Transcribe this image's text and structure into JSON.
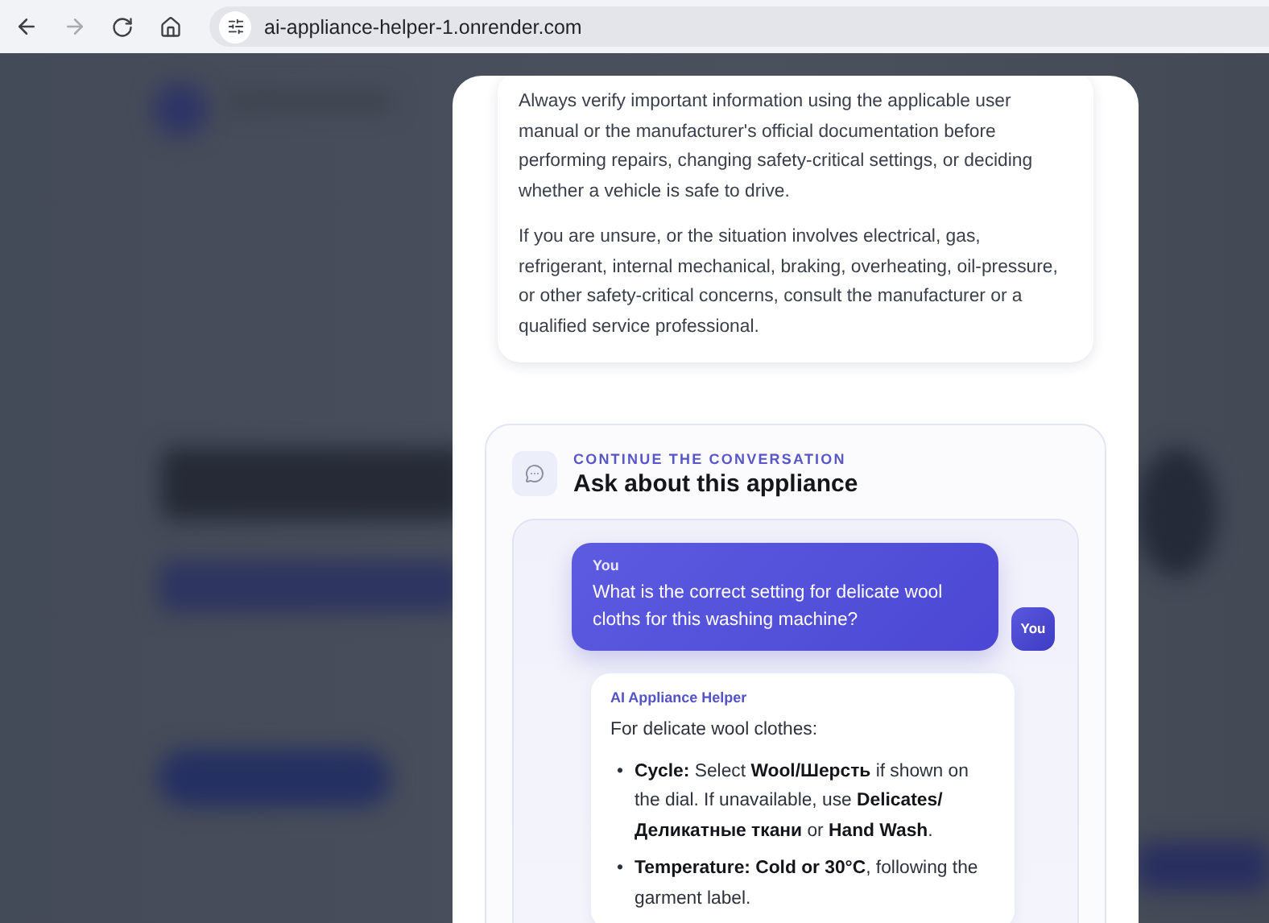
{
  "browser": {
    "url": "ai-appliance-helper-1.onrender.com",
    "forward_disabled": true
  },
  "disclaimer": {
    "paragraphs": [
      "Always verify important information using the applicable user manual or the manufacturer's official documentation before performing repairs, changing safety-critical settings, or deciding whether a vehicle is safe to drive.",
      "If you are unsure, or the situation involves electrical, gas, refrigerant, internal mechanical, braking, overheating, oil-pressure, or other safety-critical concerns, consult the manufacturer or a qualified service professional."
    ]
  },
  "chat": {
    "eyebrow": "CONTINUE THE CONVERSATION",
    "title": "Ask about this appliance",
    "messages": [
      {
        "kind": "user",
        "author": "You",
        "text": "What is the correct setting for delicate wool cloths for this washing machine?",
        "avatar": "You"
      },
      {
        "kind": "assistant",
        "author": "AI Appliance Helper",
        "intro": "For delicate wool clothes:",
        "bullet_marker": "•",
        "bullets": [
          "**Cycle:** Select **Wool/Шерсть** if shown on the dial. If unavailable, use **Delicates/ Деликатные ткани** or **Hand Wash**.",
          "**Temperature: Cold or 30°C**, following the garment label."
        ]
      }
    ]
  }
}
